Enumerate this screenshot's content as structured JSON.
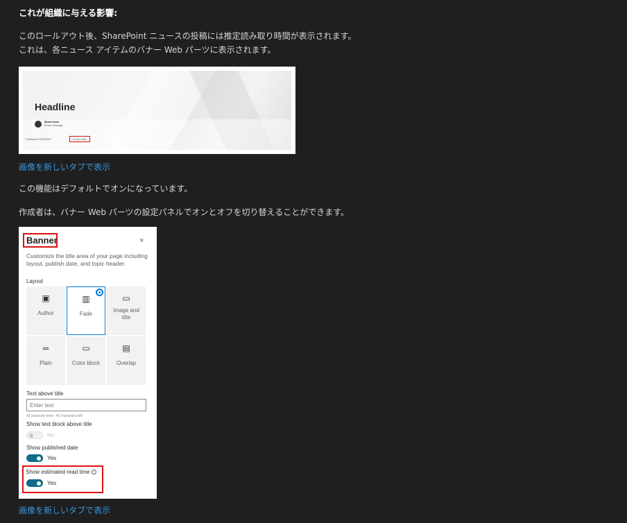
{
  "heading": "これが組織に与える影響:",
  "intro_line1": "このロールアウト後、SharePoint ニュースの投稿には推定読み取り時間が表示されます。",
  "intro_line2": "これは、各ニュース アイテムのバナー Web パーツに表示されます。",
  "banner_image": {
    "headline": "Headline",
    "author_name": "Mona Kane",
    "author_role": "Product Manager",
    "published": "Published 2/28/2023",
    "read_time": "• 8 min read"
  },
  "open_image_link_1": "画像を新しいタブで表示",
  "default_on_text": "この機能はデフォルトでオンになっています。",
  "authors_text": "作成者は、バナー Web パーツの設定パネルでオンとオフを切り替えることができます。",
  "panel": {
    "title": "Banner",
    "close_glyph": "×",
    "description": "Customize the title area of your page including layout, publish date, and topic header.",
    "layout_label": "Layout",
    "layouts": [
      {
        "label": "Author",
        "icon": "author-icon",
        "glyph": "▣",
        "selected": false
      },
      {
        "label": "Fade",
        "icon": "fade-icon",
        "glyph": "▥",
        "selected": true
      },
      {
        "label": "Image and title",
        "icon": "image-and-title-icon",
        "glyph": "▭",
        "selected": false
      },
      {
        "label": "Plain",
        "icon": "plain-icon",
        "glyph": "═",
        "selected": false
      },
      {
        "label": "Color block",
        "icon": "color-block-icon",
        "glyph": "▭",
        "selected": false
      },
      {
        "label": "Overlap",
        "icon": "overlap-icon",
        "glyph": "▤",
        "selected": false
      }
    ],
    "text_above_title_label": "Text above title",
    "text_above_title_placeholder": "Enter text",
    "char_limit": "40 character limit - 40 characters left",
    "show_text_block_label": "Show text block above title",
    "show_text_block_state": "No",
    "show_published_label": "Show published date",
    "show_published_state": "Yes",
    "show_read_time_label": "Show estimated read time",
    "show_read_time_state": "Yes",
    "accent_color": "#0f6c8a"
  },
  "open_image_link_2": "画像を新しいタブで表示"
}
